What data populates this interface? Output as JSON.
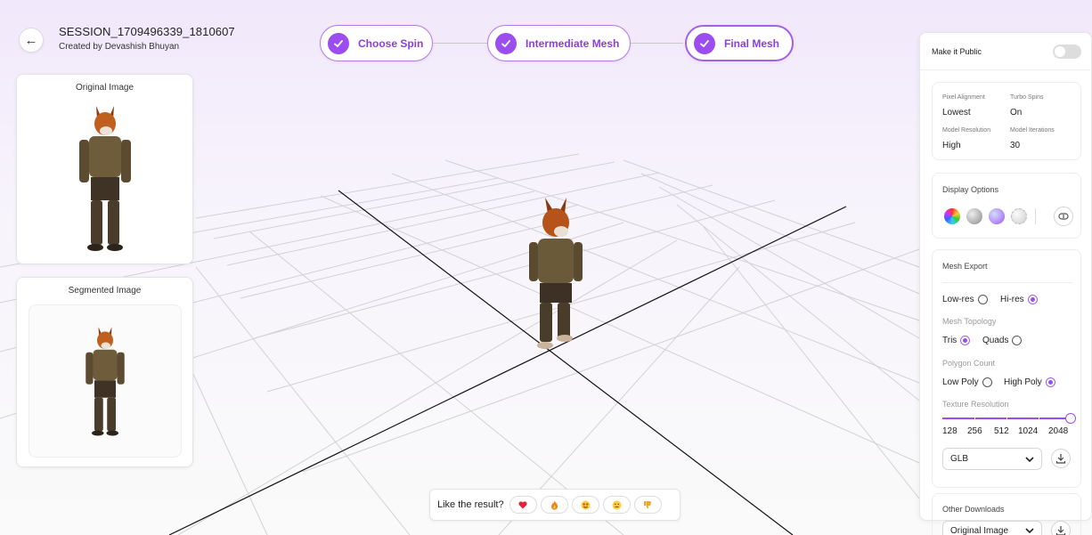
{
  "header": {
    "session_title": "SESSION_1709496339_1810607",
    "created_by": "Created by Devashish Bhuyan"
  },
  "steps": [
    {
      "label": "Choose Spin",
      "done": true
    },
    {
      "label": "Intermediate Mesh",
      "done": true
    },
    {
      "label": "Final Mesh",
      "done": true,
      "active": true
    }
  ],
  "left_panel": {
    "original_title": "Original Image",
    "segmented_title": "Segmented Image"
  },
  "right_panel": {
    "public_label": "Make it Public",
    "public_on": false,
    "settings": {
      "pixel_alignment_label": "Pixel Alignment",
      "pixel_alignment_value": "Lowest",
      "turbo_spins_label": "Turbo Spins",
      "turbo_spins_value": "On",
      "model_resolution_label": "Model Resolution",
      "model_resolution_value": "High",
      "model_iterations_label": "Model Iterations",
      "model_iterations_value": "30"
    },
    "display_options_label": "Display Options",
    "display_swatches": [
      "rainbow-normal-icon",
      "gray-matcap-icon",
      "iridescent-matcap-icon",
      "wireframe-matcap-icon"
    ],
    "mesh_export_label": "Mesh Export",
    "resolution_options": [
      {
        "label": "Low-res",
        "selected": false
      },
      {
        "label": "Hi-res",
        "selected": true
      }
    ],
    "topology_label": "Mesh Topology",
    "topology_options": [
      {
        "label": "Tris",
        "selected": true
      },
      {
        "label": "Quads",
        "selected": false
      }
    ],
    "polycount_label": "Polygon Count",
    "polycount_options": [
      {
        "label": "Low Poly",
        "selected": false
      },
      {
        "label": "High Poly",
        "selected": true
      }
    ],
    "texture_label": "Texture Resolution",
    "texture_ticks": [
      "128",
      "256",
      "512",
      "1024",
      "2048"
    ],
    "texture_selected_index": 4,
    "format_value": "GLB",
    "other_downloads_label": "Other Downloads",
    "other_downloads_value": "Original Image"
  },
  "feedback": {
    "label": "Like the result?",
    "reactions": [
      "heart-icon",
      "fire-icon",
      "star-struck-icon",
      "neutral-face-icon",
      "thumbs-down-icon"
    ]
  },
  "colors": {
    "accent": "#9c4df0",
    "accent_border": "#b37ae8"
  }
}
